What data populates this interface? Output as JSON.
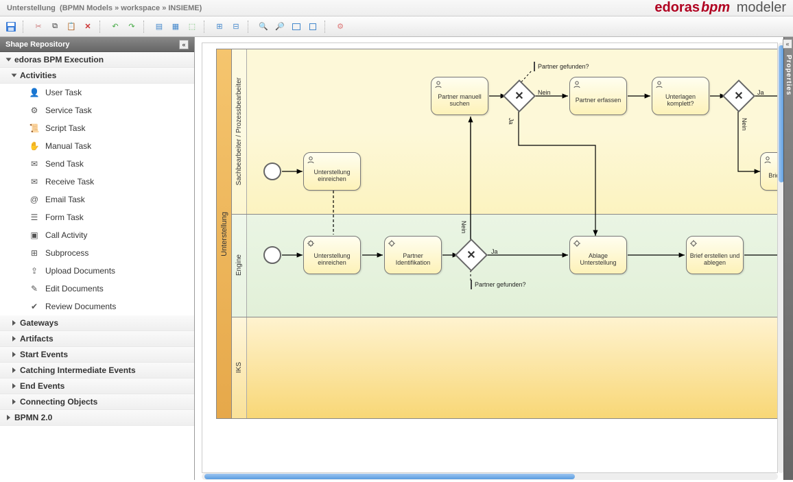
{
  "breadcrumb": {
    "model": "Unterstellung",
    "path1": "BPMN Models",
    "path2": "workspace",
    "path3": "INSIEME"
  },
  "brand": {
    "a": "edoras",
    "b": "bpm",
    "c": "modeler"
  },
  "toolbar": [
    "save",
    "cut",
    "copy",
    "paste",
    "delete",
    "undo",
    "redo",
    "align-left",
    "align-center",
    "distribute",
    "group",
    "ungroup",
    "zoom-in",
    "zoom-out",
    "fit-page",
    "actual-size",
    "validate"
  ],
  "sidebar": {
    "title": "Shape Repository",
    "sections": [
      {
        "label": "edoras BPM Execution",
        "open": true,
        "root": true
      },
      {
        "label": "Activities",
        "open": true,
        "leaves": [
          {
            "icon": "user",
            "label": "User Task"
          },
          {
            "icon": "gear",
            "label": "Service Task"
          },
          {
            "icon": "script",
            "label": "Script Task"
          },
          {
            "icon": "hand",
            "label": "Manual Task"
          },
          {
            "icon": "mail-filled",
            "label": "Send Task"
          },
          {
            "icon": "mail",
            "label": "Receive Task"
          },
          {
            "icon": "at",
            "label": "Email Task"
          },
          {
            "icon": "form",
            "label": "Form Task"
          },
          {
            "icon": "call",
            "label": "Call Activity"
          },
          {
            "icon": "sub",
            "label": "Subprocess"
          },
          {
            "icon": "upload",
            "label": "Upload Documents"
          },
          {
            "icon": "edit",
            "label": "Edit Documents"
          },
          {
            "icon": "review",
            "label": "Review Documents"
          }
        ]
      },
      {
        "label": "Gateways",
        "open": false
      },
      {
        "label": "Artifacts",
        "open": false
      },
      {
        "label": "Start Events",
        "open": false
      },
      {
        "label": "Catching Intermediate Events",
        "open": false
      },
      {
        "label": "End Events",
        "open": false
      },
      {
        "label": "Connecting Objects",
        "open": false
      },
      {
        "label": "BPMN 2.0",
        "open": false,
        "root": true
      }
    ]
  },
  "properties": {
    "title": "Properties"
  },
  "diagram": {
    "pool": "Unterstellung",
    "lanes": [
      "Sachbearbeiter / Prozessbearbeiter",
      "Engine",
      "IKS"
    ],
    "tasks": {
      "t1": {
        "label": "Unterstellung einreichen",
        "type": "user"
      },
      "t2": {
        "label": "Partner manuell suchen",
        "type": "user"
      },
      "t3": {
        "label": "Partner erfassen",
        "type": "user"
      },
      "t4": {
        "label": "Unterlagen komplett?",
        "type": "user"
      },
      "t5": {
        "label": "Brief editieren",
        "type": "user"
      },
      "t6": {
        "label": "Unterstellung einreichen",
        "type": "service"
      },
      "t7": {
        "label": "Partner Identifikation",
        "type": "service"
      },
      "t8": {
        "label": "Ablage Unterstellung",
        "type": "service"
      },
      "t9": {
        "label": "Brief erstellen und ablegen",
        "type": "service"
      }
    },
    "labels": {
      "ja": "Ja",
      "nein": "Nein",
      "partnerGefunden": "Partner gefunden?"
    }
  }
}
